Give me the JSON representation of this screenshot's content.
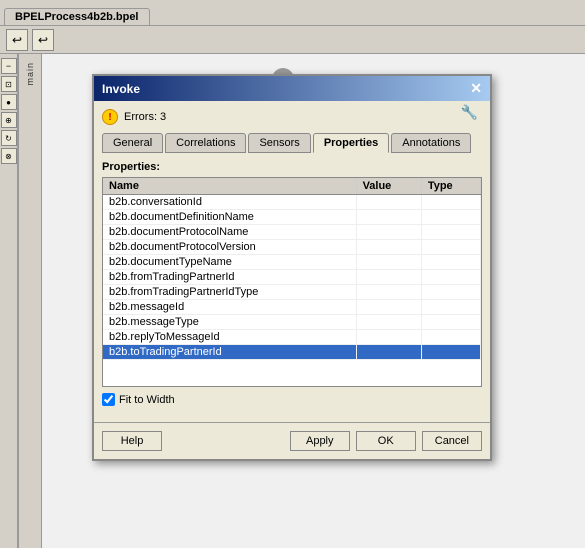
{
  "app": {
    "title": "BPELProcess4b2b.bpel"
  },
  "toolbar": {
    "btn1_label": "↩",
    "btn2_label": "↩"
  },
  "sidebar": {
    "collapse_label": "−",
    "tool_labels": [
      "⊡",
      "⊙",
      "⊗",
      "⊕",
      "⊛",
      "⊜"
    ]
  },
  "canvas": {
    "vertical_label": "main"
  },
  "dialog": {
    "title": "Invoke",
    "close_label": "✕",
    "error_text": "Errors: 3",
    "wrench_label": "🔧",
    "tabs": [
      "General",
      "Correlations",
      "Sensors",
      "Properties",
      "Annotations"
    ],
    "active_tab": "Properties",
    "properties_label": "Properties:",
    "table": {
      "columns": [
        "Name",
        "Value",
        "Type"
      ],
      "rows": [
        {
          "name": "b2b.conversationId",
          "value": "",
          "type": ""
        },
        {
          "name": "b2b.documentDefinitionName",
          "value": "",
          "type": ""
        },
        {
          "name": "b2b.documentProtocolName",
          "value": "",
          "type": ""
        },
        {
          "name": "b2b.documentProtocolVersion",
          "value": "",
          "type": ""
        },
        {
          "name": "b2b.documentTypeName",
          "value": "",
          "type": ""
        },
        {
          "name": "b2b.fromTradingPartnerId",
          "value": "",
          "type": ""
        },
        {
          "name": "b2b.fromTradingPartnerIdType",
          "value": "",
          "type": ""
        },
        {
          "name": "b2b.messageId",
          "value": "",
          "type": ""
        },
        {
          "name": "b2b.messageType",
          "value": "",
          "type": ""
        },
        {
          "name": "b2b.replyToMessageId",
          "value": "",
          "type": ""
        },
        {
          "name": "b2b.toTradingPartnerId",
          "value": "",
          "type": ""
        }
      ]
    },
    "fit_to_width_label": "Fit to Width",
    "fit_to_width_checked": true
  },
  "footer": {
    "help_label": "Help",
    "apply_label": "Apply",
    "ok_label": "OK",
    "cancel_label": "Cancel"
  }
}
